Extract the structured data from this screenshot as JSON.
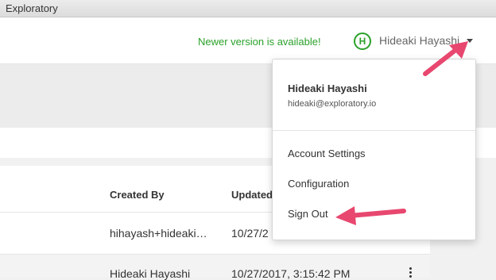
{
  "window": {
    "title": "Exploratory"
  },
  "header": {
    "update_notice": "Newer version is available!",
    "avatar_initial": "H",
    "user_name": "Hideaki Hayashi"
  },
  "user_dropdown": {
    "name": "Hideaki Hayashi",
    "email": "hideaki@exploratory.io",
    "items": [
      "Account Settings",
      "Configuration",
      "Sign Out"
    ]
  },
  "table": {
    "columns": {
      "created_by": "Created By",
      "updated": "Updated"
    },
    "rows": [
      {
        "created_by": "hihayash+hideaki…",
        "updated": "10/27/2"
      },
      {
        "created_by": "Hideaki Hayashi",
        "updated": "10/27/2017, 3:15:42 PM"
      }
    ]
  },
  "colors": {
    "accent_green": "#2aa12a",
    "annotation_pink": "#e8476f"
  }
}
